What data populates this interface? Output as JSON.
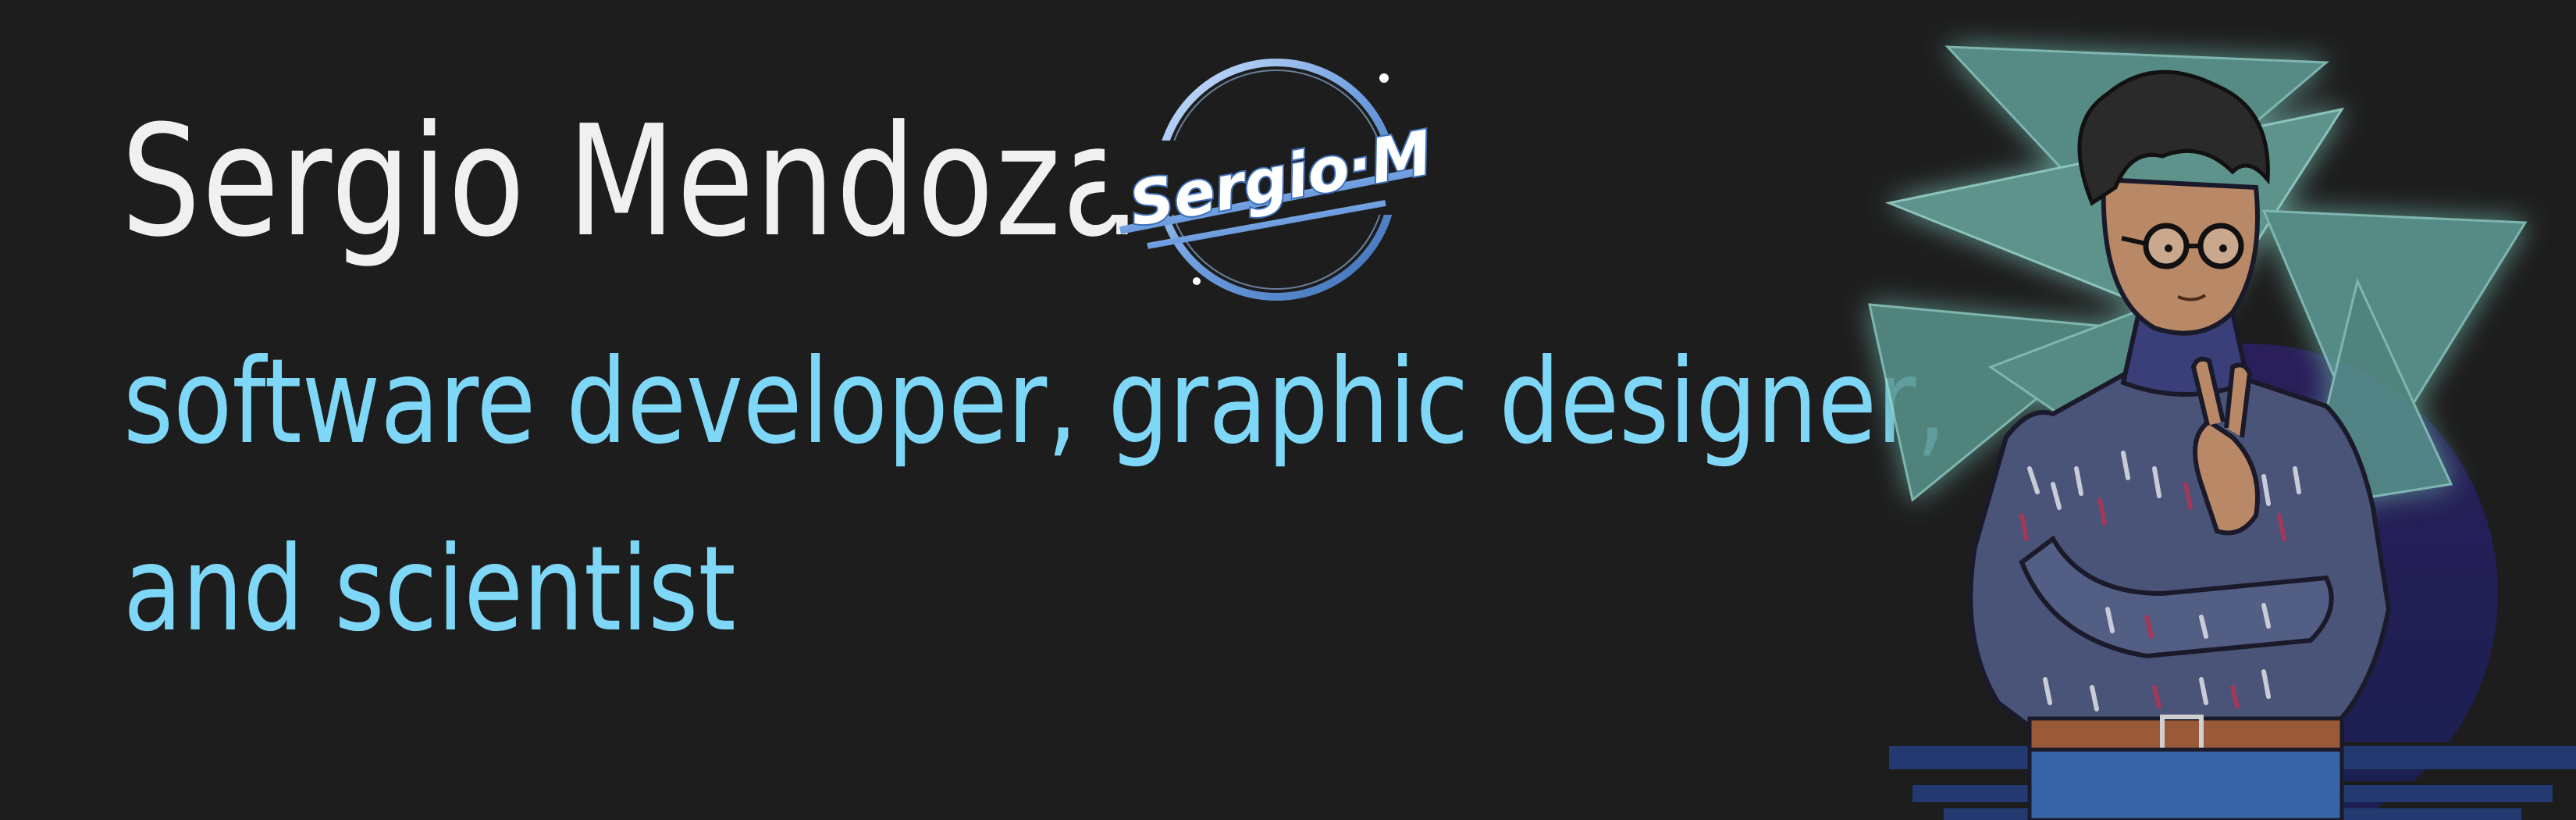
{
  "banner": {
    "name": "Sergio Mendoza",
    "tagline_line1": "software developer, graphic designer,",
    "tagline_line2": "and scientist",
    "logo_text": "Sergio·M"
  },
  "colors": {
    "background": "#1d1d1d",
    "name": "#f0f0f0",
    "tagline": "#7fd7f7",
    "logo_blue": "#6f9fe0",
    "triangle_teal": "#5f9f96",
    "sweater": "#4a5478",
    "stripe_purple": "#2a2060"
  },
  "icons": {
    "logo": "sergio-m-logo-icon",
    "portrait": "cartoon-portrait-illustration"
  }
}
